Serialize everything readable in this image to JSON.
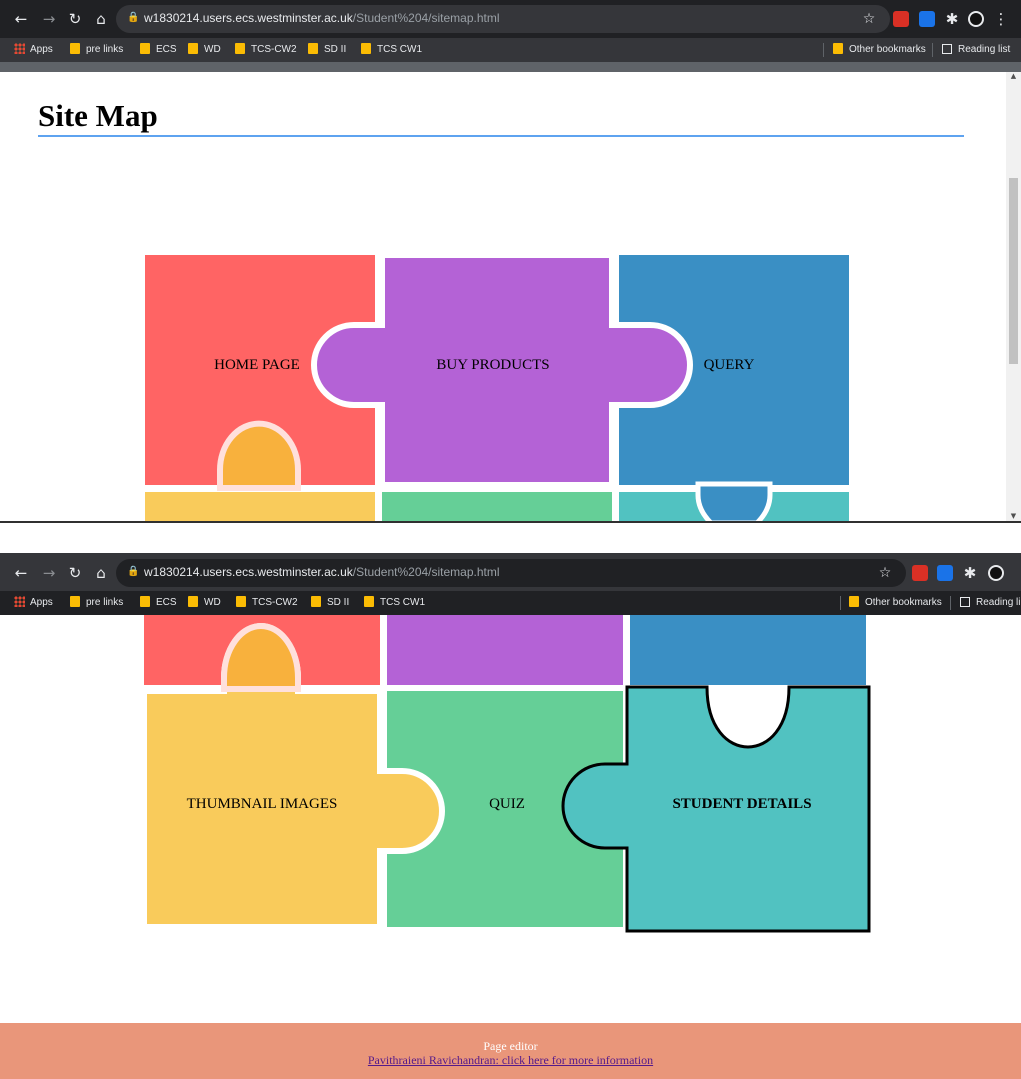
{
  "browser": {
    "url_host": "w1830214.users.ecs.westminster.ac.uk",
    "url_path": "/Student%204/sitemap.html",
    "bookmarks": [
      "Apps",
      "pre links",
      "ECS",
      "WD",
      "TCS-CW2",
      "SD II",
      "TCS CW1"
    ],
    "other_bookmarks": "Other bookmarks",
    "reading_list": "Reading list",
    "reading_list_truncated": "Reading li"
  },
  "page": {
    "title": "Site Map",
    "pieces": {
      "home": "HOME PAGE",
      "buy": "BUY PRODUCTS",
      "query": "QUERY",
      "thumbnails": "THUMBNAIL IMAGES",
      "quiz": "QUIZ",
      "student": "STUDENT DETAILS"
    },
    "colors": {
      "home": "#ff6464",
      "buy": "#b462d6",
      "query": "#3a8fc4",
      "thumbnails": "#f9cb5b",
      "quiz": "#65cf97",
      "student": "#51c2c1",
      "knob_overlap": "#f8b13d"
    },
    "footer": {
      "title": "Page editor",
      "link": "Pavithraieni Ravichandran: click here for more information"
    }
  }
}
